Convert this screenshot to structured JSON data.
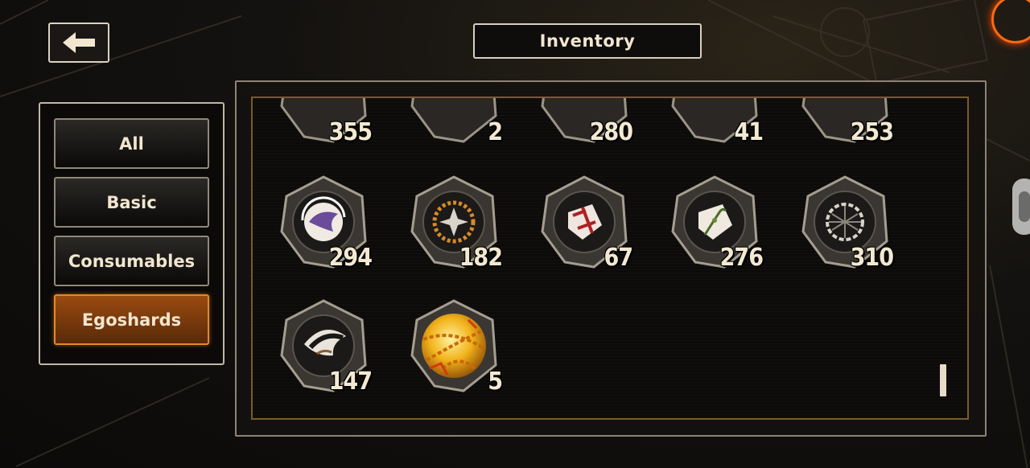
{
  "header": {
    "title": "Inventory"
  },
  "icons": {
    "back": "back-arrow-icon"
  },
  "sidebar": {
    "categories": [
      {
        "label": "All",
        "active": false
      },
      {
        "label": "Basic",
        "active": false
      },
      {
        "label": "Consumables",
        "active": false
      },
      {
        "label": "Egoshards",
        "active": true
      }
    ]
  },
  "inventory": {
    "top_row_counts": [
      "355",
      "2",
      "280",
      "41",
      "253"
    ],
    "row2": [
      {
        "count": "294",
        "icon": "purple-bird-emblem-icon"
      },
      {
        "count": "182",
        "icon": "chain-star-emblem-icon"
      },
      {
        "count": "67",
        "icon": "bloody-shard-emblem-icon"
      },
      {
        "count": "276",
        "icon": "vine-shard-emblem-icon"
      },
      {
        "count": "310",
        "icon": "net-emblem-icon"
      }
    ],
    "row3": [
      {
        "count": "147",
        "icon": "black-feather-emblem-icon"
      },
      {
        "count": "5",
        "icon": "golden-chained-orb-icon"
      }
    ]
  },
  "colors": {
    "accent": "#e08a2a",
    "active_bg": "#9a4a10",
    "text": "#f1e6cf"
  }
}
